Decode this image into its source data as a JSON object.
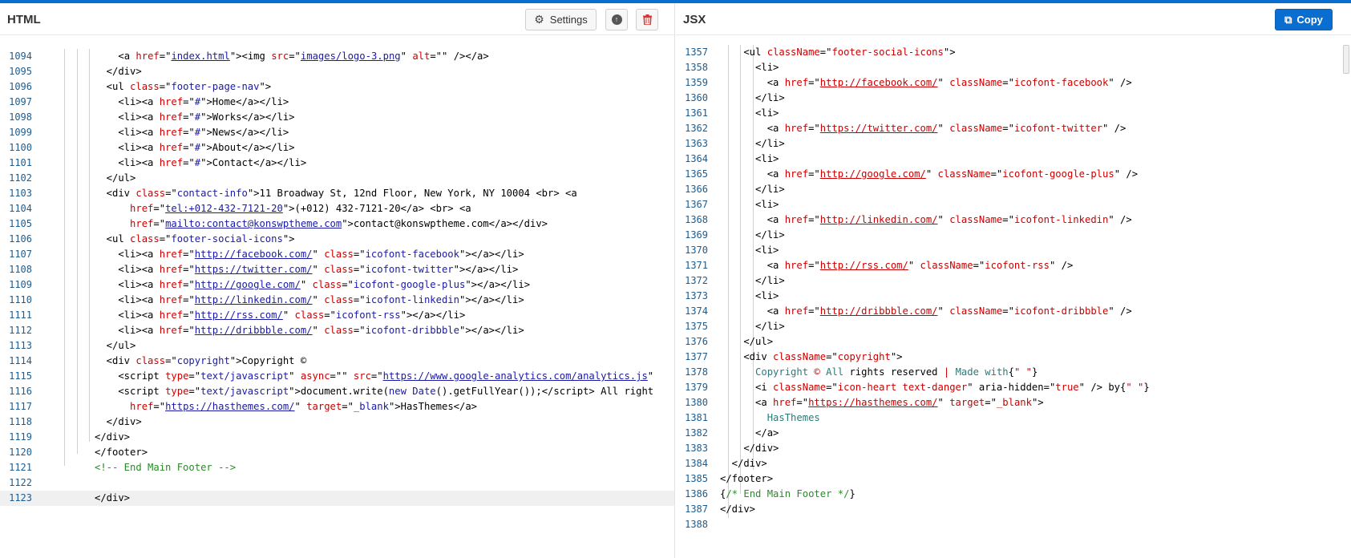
{
  "left": {
    "title": "HTML",
    "settings_label": "Settings",
    "settings_icon": "gear-icon",
    "upload_icon": "arrow-up-circle-icon",
    "delete_icon": "trash-icon",
    "lines": [
      {
        "n": "1094",
        "html": "    <span class=\"tag\">&lt;a</span> <span class=\"attr\">href</span>=\"<span class=\"url\">index.html</span>\"&gt;&lt;img <span class=\"attr\">src</span>=\"<span class=\"url\">images/logo-3.png</span>\" <span class=\"attr\">alt</span>=\"<span class=\"val\"></span>\" /&gt;&lt;/a&gt;"
      },
      {
        "n": "1095",
        "html": "  &lt;/div&gt;"
      },
      {
        "n": "1096",
        "html": "  &lt;ul <span class=\"attr\">class</span>=\"<span class=\"val\">footer-page-nav</span>\"&gt;"
      },
      {
        "n": "1097",
        "html": "    &lt;li&gt;&lt;a <span class=\"attr\">href</span>=\"<span class=\"val\">#</span>\"&gt;Home&lt;/a&gt;&lt;/li&gt;"
      },
      {
        "n": "1098",
        "html": "    &lt;li&gt;&lt;a <span class=\"attr\">href</span>=\"<span class=\"val\">#</span>\"&gt;Works&lt;/a&gt;&lt;/li&gt;"
      },
      {
        "n": "1099",
        "html": "    &lt;li&gt;&lt;a <span class=\"attr\">href</span>=\"<span class=\"val\">#</span>\"&gt;News&lt;/a&gt;&lt;/li&gt;"
      },
      {
        "n": "1100",
        "html": "    &lt;li&gt;&lt;a <span class=\"attr\">href</span>=\"<span class=\"val\">#</span>\"&gt;About&lt;/a&gt;&lt;/li&gt;"
      },
      {
        "n": "1101",
        "html": "    &lt;li&gt;&lt;a <span class=\"attr\">href</span>=\"<span class=\"val\">#</span>\"&gt;Contact&lt;/a&gt;&lt;/li&gt;"
      },
      {
        "n": "1102",
        "html": "  &lt;/ul&gt;"
      },
      {
        "n": "1103",
        "html": "  &lt;div <span class=\"attr\">class</span>=\"<span class=\"val\">contact-info</span>\"&gt;11 Broadway St, 12nd Floor, New York, NY 10004 &lt;br&gt; &lt;a"
      },
      {
        "n": "1104",
        "html": "      <span class=\"attr\">href</span>=\"<span class=\"url\">tel:+012-432-7121-20</span>\"&gt;(+012) 432-7121-20&lt;/a&gt; &lt;br&gt; &lt;a"
      },
      {
        "n": "1105",
        "html": "      <span class=\"attr\">href</span>=\"<span class=\"url\">mailto:contact@konswptheme.com</span>\"&gt;contact@konswptheme.com&lt;/a&gt;&lt;/div&gt;"
      },
      {
        "n": "1106",
        "html": "  &lt;ul <span class=\"attr\">class</span>=\"<span class=\"val\">footer-social-icons</span>\"&gt;"
      },
      {
        "n": "1107",
        "html": "    &lt;li&gt;&lt;a <span class=\"attr\">href</span>=\"<span class=\"url\">http://facebook.com/</span>\" <span class=\"attr\">class</span>=\"<span class=\"val\">icofont-facebook</span>\"&gt;&lt;/a&gt;&lt;/li&gt;"
      },
      {
        "n": "1108",
        "html": "    &lt;li&gt;&lt;a <span class=\"attr\">href</span>=\"<span class=\"url\">https://twitter.com/</span>\" <span class=\"attr\">class</span>=\"<span class=\"val\">icofont-twitter</span>\"&gt;&lt;/a&gt;&lt;/li&gt;"
      },
      {
        "n": "1109",
        "html": "    &lt;li&gt;&lt;a <span class=\"attr\">href</span>=\"<span class=\"url\">http://google.com/</span>\" <span class=\"attr\">class</span>=\"<span class=\"val\">icofont-google-plus</span>\"&gt;&lt;/a&gt;&lt;/li&gt;"
      },
      {
        "n": "1110",
        "html": "    &lt;li&gt;&lt;a <span class=\"attr\">href</span>=\"<span class=\"url\">http://linkedin.com/</span>\" <span class=\"attr\">class</span>=\"<span class=\"val\">icofont-linkedin</span>\"&gt;&lt;/a&gt;&lt;/li&gt;"
      },
      {
        "n": "1111",
        "html": "    &lt;li&gt;&lt;a <span class=\"attr\">href</span>=\"<span class=\"url\">http://rss.com/</span>\" <span class=\"attr\">class</span>=\"<span class=\"val\">icofont-rss</span>\"&gt;&lt;/a&gt;&lt;/li&gt;"
      },
      {
        "n": "1112",
        "html": "    &lt;li&gt;&lt;a <span class=\"attr\">href</span>=\"<span class=\"url\">http://dribbble.com/</span>\" <span class=\"attr\">class</span>=\"<span class=\"val\">icofont-dribbble</span>\"&gt;&lt;/a&gt;&lt;/li&gt;"
      },
      {
        "n": "1113",
        "html": "  &lt;/ul&gt;"
      },
      {
        "n": "1114",
        "html": "  &lt;div <span class=\"attr\">class</span>=\"<span class=\"val\">copyright</span>\"&gt;Copyright ©"
      },
      {
        "n": "1115",
        "html": "    &lt;script <span class=\"attr\">type</span>=\"<span class=\"val\">text/javascript</span>\" <span class=\"attr\">async</span>=\"\" <span class=\"attr\">src</span>=\"<span class=\"url\">https://www.google-analytics.com/analytics.js</span>\""
      },
      {
        "n": "1116",
        "html": "    &lt;script <span class=\"attr\">type</span>=\"<span class=\"val\">text/javascript</span>\"&gt;document.write(<span class=\"kw\">new</span> <span class=\"kw\">Date</span>().getFullYear());&lt;/script&gt; All right"
      },
      {
        "n": "1117",
        "html": "      <span class=\"attr\">href</span>=\"<span class=\"url\">https://hasthemes.com/</span>\" <span class=\"attr\">target</span>=\"<span class=\"val\">_blank</span>\"&gt;HasThemes&lt;/a&gt;"
      },
      {
        "n": "1118",
        "html": "  &lt;/div&gt;"
      },
      {
        "n": "1119",
        "html": "&lt;/div&gt;"
      },
      {
        "n": "1120",
        "html": "&lt;/footer&gt;"
      },
      {
        "n": "1121",
        "html": "<span class=\"comment\">&lt;!-- End Main Footer --&gt;</span>"
      },
      {
        "n": "1122",
        "html": ""
      },
      {
        "n": "1123",
        "html": "&lt;/div&gt;"
      }
    ]
  },
  "right": {
    "title": "JSX",
    "copy_label": "Copy",
    "copy_icon": "copy-icon",
    "lines": [
      {
        "n": "1357",
        "html": "    &lt;ul <span class=\"attr\">className</span>=\"<span class=\"attr\">footer-social-icons</span>\"&gt;"
      },
      {
        "n": "1358",
        "html": "      &lt;li&gt;"
      },
      {
        "n": "1359",
        "html": "        &lt;a <span class=\"attr\">href</span>=\"<span class=\"rurl\">http://facebook.com/</span>\" <span class=\"attr\">className</span>=\"<span class=\"attr\">icofont-facebook</span>\" /&gt;"
      },
      {
        "n": "1360",
        "html": "      &lt;/li&gt;"
      },
      {
        "n": "1361",
        "html": "      &lt;li&gt;"
      },
      {
        "n": "1362",
        "html": "        &lt;a <span class=\"attr\">href</span>=\"<span class=\"rurl\">https://twitter.com/</span>\" <span class=\"attr\">className</span>=\"<span class=\"attr\">icofont-twitter</span>\" /&gt;"
      },
      {
        "n": "1363",
        "html": "      &lt;/li&gt;"
      },
      {
        "n": "1364",
        "html": "      &lt;li&gt;"
      },
      {
        "n": "1365",
        "html": "        &lt;a <span class=\"attr\">href</span>=\"<span class=\"rurl\">http://google.com/</span>\" <span class=\"attr\">className</span>=\"<span class=\"attr\">icofont-google-plus</span>\" /&gt;"
      },
      {
        "n": "1366",
        "html": "      &lt;/li&gt;"
      },
      {
        "n": "1367",
        "html": "      &lt;li&gt;"
      },
      {
        "n": "1368",
        "html": "        &lt;a <span class=\"attr\">href</span>=\"<span class=\"rurl\">http://linkedin.com/</span>\" <span class=\"attr\">className</span>=\"<span class=\"attr\">icofont-linkedin</span>\" /&gt;"
      },
      {
        "n": "1369",
        "html": "      &lt;/li&gt;"
      },
      {
        "n": "1370",
        "html": "      &lt;li&gt;"
      },
      {
        "n": "1371",
        "html": "        &lt;a <span class=\"attr\">href</span>=\"<span class=\"rurl\">http://rss.com/</span>\" <span class=\"attr\">className</span>=\"<span class=\"attr\">icofont-rss</span>\" /&gt;"
      },
      {
        "n": "1372",
        "html": "      &lt;/li&gt;"
      },
      {
        "n": "1373",
        "html": "      &lt;li&gt;"
      },
      {
        "n": "1374",
        "html": "        &lt;a <span class=\"attr\">href</span>=\"<span class=\"rurl\">http://dribbble.com/</span>\" <span class=\"attr\">className</span>=\"<span class=\"attr\">icofont-dribbble</span>\" /&gt;"
      },
      {
        "n": "1375",
        "html": "      &lt;/li&gt;"
      },
      {
        "n": "1376",
        "html": "    &lt;/ul&gt;"
      },
      {
        "n": "1377",
        "html": "    &lt;div <span class=\"attr\">className</span>=\"<span class=\"attr\">copyright</span>\"&gt;"
      },
      {
        "n": "1378",
        "html": "      <span class=\"jsxtext\">Copyright</span> <span class=\"attr\">©</span> <span class=\"jsxtext\">All</span> rights reserved <span class=\"attr\">|</span> <span class=\"jsxtext\">Made</span> <span class=\"jsxtext\">with</span>{<span class=\"attr\">\" \"</span>}"
      },
      {
        "n": "1379",
        "html": "      &lt;i <span class=\"attr\">className</span>=\"<span class=\"attr\">icon-heart text-danger</span>\" aria-hidden=\"<span class=\"attr\">true</span>\" /&gt; by{<span class=\"attr\">\" \"</span>}"
      },
      {
        "n": "1380",
        "html": "      &lt;a <span class=\"attr\">href</span>=\"<span class=\"rurl\">https://hasthemes.com/</span>\" <span class=\"attr\">target</span>=\"<span class=\"attr\">_blank</span>\"&gt;"
      },
      {
        "n": "1381",
        "html": "        <span class=\"jsxtext\">HasThemes</span>"
      },
      {
        "n": "1382",
        "html": "      &lt;/a&gt;"
      },
      {
        "n": "1383",
        "html": "    &lt;/div&gt;"
      },
      {
        "n": "1384",
        "html": "  &lt;/div&gt;"
      },
      {
        "n": "1385",
        "html": "&lt;/footer&gt;"
      },
      {
        "n": "1386",
        "html": "{<span class=\"comment\">/* End Main Footer */</span>}"
      },
      {
        "n": "1387",
        "html": "&lt;/div&gt;"
      },
      {
        "n": "1388",
        "html": ""
      }
    ]
  }
}
